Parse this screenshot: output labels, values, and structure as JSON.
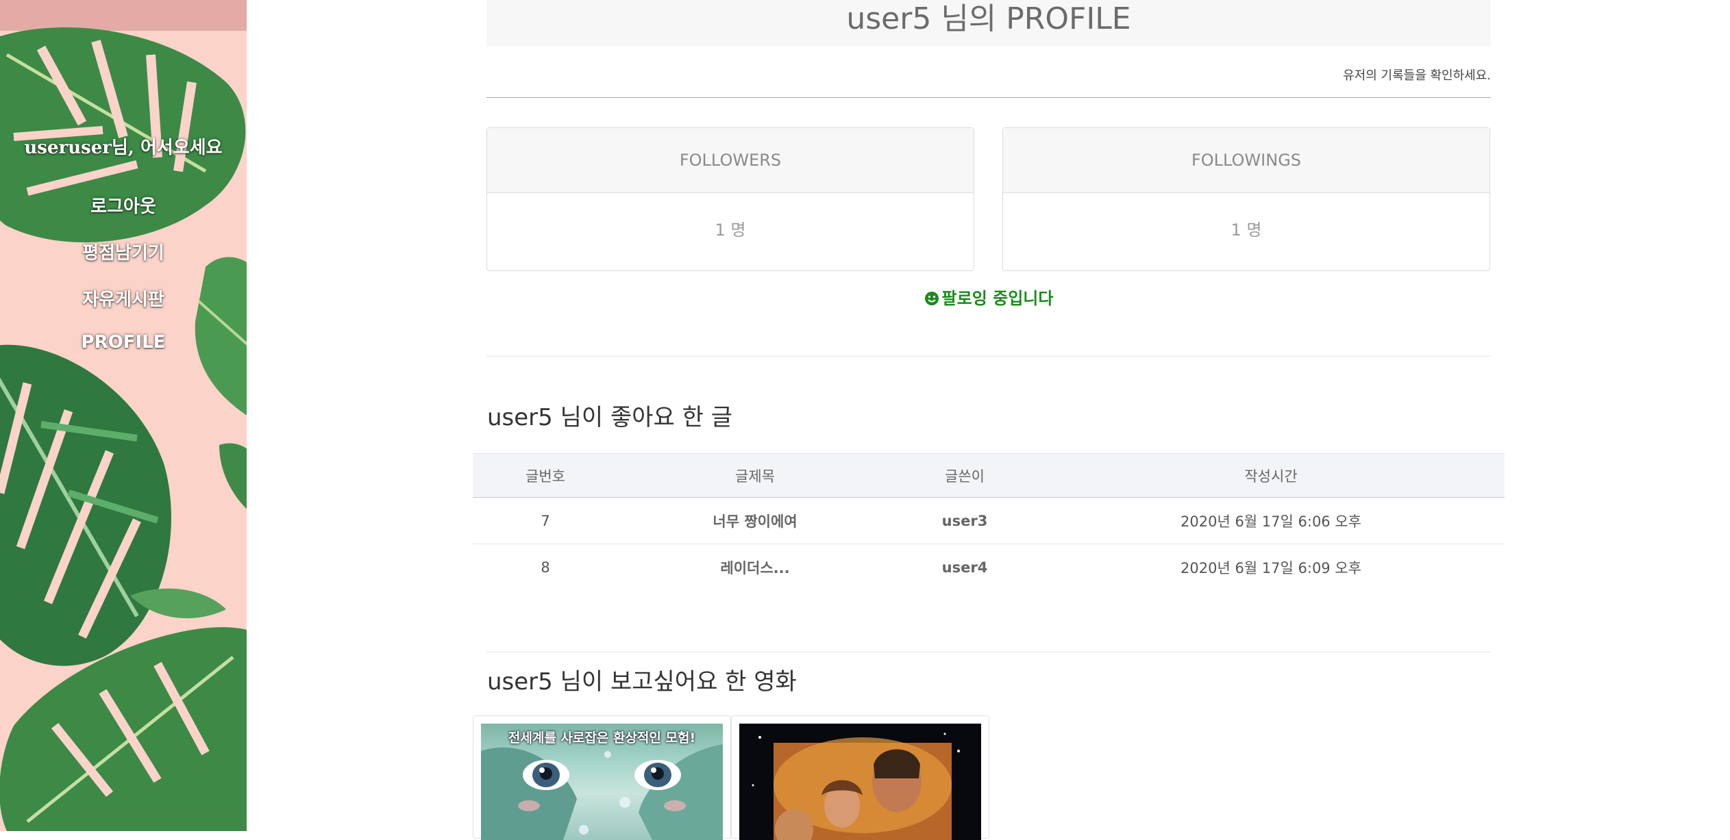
{
  "sidebar": {
    "greeting": "useruser님, 어서오세요",
    "menu": [
      {
        "label": "로그아웃"
      },
      {
        "label": "평점남기기"
      },
      {
        "label": "자유게시판"
      },
      {
        "label": "PROFILE"
      }
    ]
  },
  "profile": {
    "title": "user5 님의 PROFILE",
    "subtitle": "유저의 기록들을 확인하세요.",
    "followers": {
      "label": "FOLLOWERS",
      "count": "1 명"
    },
    "followings": {
      "label": "FOLLOWINGS",
      "count": "1 명"
    },
    "follow_status": "팔로잉 중입니다"
  },
  "likes": {
    "title": "user5 님이 좋아요 한 글",
    "columns": [
      "글번호",
      "글제목",
      "글쓴이",
      "작성시간"
    ],
    "rows": [
      {
        "no": "7",
        "title": "너무 짱이에여",
        "author": "user3",
        "time": "2020년 6월 17일 6:06 오후"
      },
      {
        "no": "8",
        "title": "레이더스...",
        "author": "user4",
        "time": "2020년 6월 17일 6:09 오후"
      }
    ]
  },
  "wants": {
    "title": "user5 님이 보고싶어요 한 영화",
    "movies": [
      {
        "poster_text": "전세계를 사로잡은 환상적인 모험!"
      },
      {
        "poster_text": ""
      }
    ]
  },
  "colors": {
    "sidebar_bg": "#fbd3c9",
    "sidebar_top": "#e4aaa6",
    "leaf_green": "#2f7a3c",
    "follow_status": "#1a8a1a"
  }
}
